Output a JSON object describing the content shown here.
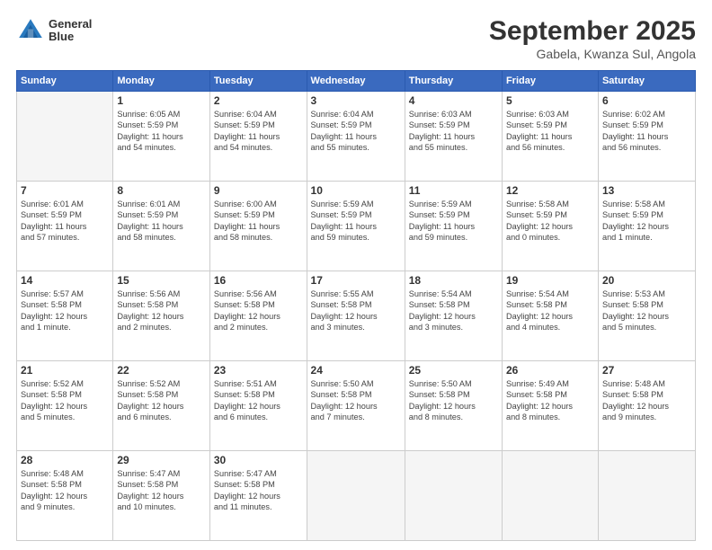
{
  "header": {
    "logo_line1": "General",
    "logo_line2": "Blue",
    "month": "September 2025",
    "location": "Gabela, Kwanza Sul, Angola"
  },
  "weekdays": [
    "Sunday",
    "Monday",
    "Tuesday",
    "Wednesday",
    "Thursday",
    "Friday",
    "Saturday"
  ],
  "weeks": [
    [
      {
        "day": "",
        "info": ""
      },
      {
        "day": "1",
        "info": "Sunrise: 6:05 AM\nSunset: 5:59 PM\nDaylight: 11 hours\nand 54 minutes."
      },
      {
        "day": "2",
        "info": "Sunrise: 6:04 AM\nSunset: 5:59 PM\nDaylight: 11 hours\nand 54 minutes."
      },
      {
        "day": "3",
        "info": "Sunrise: 6:04 AM\nSunset: 5:59 PM\nDaylight: 11 hours\nand 55 minutes."
      },
      {
        "day": "4",
        "info": "Sunrise: 6:03 AM\nSunset: 5:59 PM\nDaylight: 11 hours\nand 55 minutes."
      },
      {
        "day": "5",
        "info": "Sunrise: 6:03 AM\nSunset: 5:59 PM\nDaylight: 11 hours\nand 56 minutes."
      },
      {
        "day": "6",
        "info": "Sunrise: 6:02 AM\nSunset: 5:59 PM\nDaylight: 11 hours\nand 56 minutes."
      }
    ],
    [
      {
        "day": "7",
        "info": "Sunrise: 6:01 AM\nSunset: 5:59 PM\nDaylight: 11 hours\nand 57 minutes."
      },
      {
        "day": "8",
        "info": "Sunrise: 6:01 AM\nSunset: 5:59 PM\nDaylight: 11 hours\nand 58 minutes."
      },
      {
        "day": "9",
        "info": "Sunrise: 6:00 AM\nSunset: 5:59 PM\nDaylight: 11 hours\nand 58 minutes."
      },
      {
        "day": "10",
        "info": "Sunrise: 5:59 AM\nSunset: 5:59 PM\nDaylight: 11 hours\nand 59 minutes."
      },
      {
        "day": "11",
        "info": "Sunrise: 5:59 AM\nSunset: 5:59 PM\nDaylight: 11 hours\nand 59 minutes."
      },
      {
        "day": "12",
        "info": "Sunrise: 5:58 AM\nSunset: 5:59 PM\nDaylight: 12 hours\nand 0 minutes."
      },
      {
        "day": "13",
        "info": "Sunrise: 5:58 AM\nSunset: 5:59 PM\nDaylight: 12 hours\nand 1 minute."
      }
    ],
    [
      {
        "day": "14",
        "info": "Sunrise: 5:57 AM\nSunset: 5:58 PM\nDaylight: 12 hours\nand 1 minute."
      },
      {
        "day": "15",
        "info": "Sunrise: 5:56 AM\nSunset: 5:58 PM\nDaylight: 12 hours\nand 2 minutes."
      },
      {
        "day": "16",
        "info": "Sunrise: 5:56 AM\nSunset: 5:58 PM\nDaylight: 12 hours\nand 2 minutes."
      },
      {
        "day": "17",
        "info": "Sunrise: 5:55 AM\nSunset: 5:58 PM\nDaylight: 12 hours\nand 3 minutes."
      },
      {
        "day": "18",
        "info": "Sunrise: 5:54 AM\nSunset: 5:58 PM\nDaylight: 12 hours\nand 3 minutes."
      },
      {
        "day": "19",
        "info": "Sunrise: 5:54 AM\nSunset: 5:58 PM\nDaylight: 12 hours\nand 4 minutes."
      },
      {
        "day": "20",
        "info": "Sunrise: 5:53 AM\nSunset: 5:58 PM\nDaylight: 12 hours\nand 5 minutes."
      }
    ],
    [
      {
        "day": "21",
        "info": "Sunrise: 5:52 AM\nSunset: 5:58 PM\nDaylight: 12 hours\nand 5 minutes."
      },
      {
        "day": "22",
        "info": "Sunrise: 5:52 AM\nSunset: 5:58 PM\nDaylight: 12 hours\nand 6 minutes."
      },
      {
        "day": "23",
        "info": "Sunrise: 5:51 AM\nSunset: 5:58 PM\nDaylight: 12 hours\nand 6 minutes."
      },
      {
        "day": "24",
        "info": "Sunrise: 5:50 AM\nSunset: 5:58 PM\nDaylight: 12 hours\nand 7 minutes."
      },
      {
        "day": "25",
        "info": "Sunrise: 5:50 AM\nSunset: 5:58 PM\nDaylight: 12 hours\nand 8 minutes."
      },
      {
        "day": "26",
        "info": "Sunrise: 5:49 AM\nSunset: 5:58 PM\nDaylight: 12 hours\nand 8 minutes."
      },
      {
        "day": "27",
        "info": "Sunrise: 5:48 AM\nSunset: 5:58 PM\nDaylight: 12 hours\nand 9 minutes."
      }
    ],
    [
      {
        "day": "28",
        "info": "Sunrise: 5:48 AM\nSunset: 5:58 PM\nDaylight: 12 hours\nand 9 minutes."
      },
      {
        "day": "29",
        "info": "Sunrise: 5:47 AM\nSunset: 5:58 PM\nDaylight: 12 hours\nand 10 minutes."
      },
      {
        "day": "30",
        "info": "Sunrise: 5:47 AM\nSunset: 5:58 PM\nDaylight: 12 hours\nand 11 minutes."
      },
      {
        "day": "",
        "info": ""
      },
      {
        "day": "",
        "info": ""
      },
      {
        "day": "",
        "info": ""
      },
      {
        "day": "",
        "info": ""
      }
    ]
  ]
}
